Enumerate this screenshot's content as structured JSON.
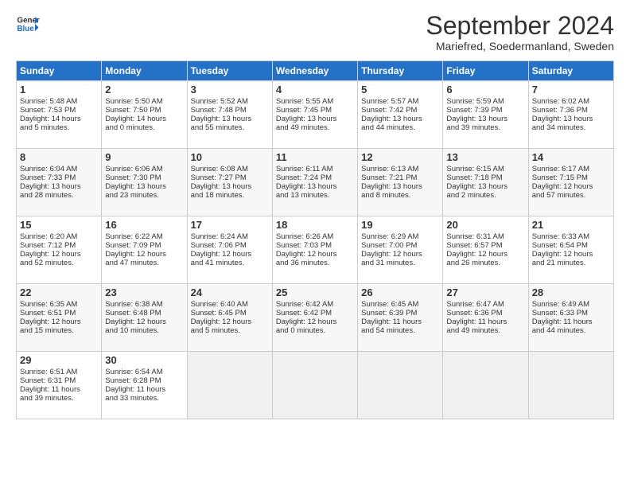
{
  "header": {
    "logo_line1": "General",
    "logo_line2": "Blue",
    "month": "September 2024",
    "location": "Mariefred, Soedermanland, Sweden"
  },
  "weekdays": [
    "Sunday",
    "Monday",
    "Tuesday",
    "Wednesday",
    "Thursday",
    "Friday",
    "Saturday"
  ],
  "weeks": [
    [
      {
        "day": "1",
        "lines": [
          "Sunrise: 5:48 AM",
          "Sunset: 7:53 PM",
          "Daylight: 14 hours",
          "and 5 minutes."
        ]
      },
      {
        "day": "2",
        "lines": [
          "Sunrise: 5:50 AM",
          "Sunset: 7:50 PM",
          "Daylight: 14 hours",
          "and 0 minutes."
        ]
      },
      {
        "day": "3",
        "lines": [
          "Sunrise: 5:52 AM",
          "Sunset: 7:48 PM",
          "Daylight: 13 hours",
          "and 55 minutes."
        ]
      },
      {
        "day": "4",
        "lines": [
          "Sunrise: 5:55 AM",
          "Sunset: 7:45 PM",
          "Daylight: 13 hours",
          "and 49 minutes."
        ]
      },
      {
        "day": "5",
        "lines": [
          "Sunrise: 5:57 AM",
          "Sunset: 7:42 PM",
          "Daylight: 13 hours",
          "and 44 minutes."
        ]
      },
      {
        "day": "6",
        "lines": [
          "Sunrise: 5:59 AM",
          "Sunset: 7:39 PM",
          "Daylight: 13 hours",
          "and 39 minutes."
        ]
      },
      {
        "day": "7",
        "lines": [
          "Sunrise: 6:02 AM",
          "Sunset: 7:36 PM",
          "Daylight: 13 hours",
          "and 34 minutes."
        ]
      }
    ],
    [
      {
        "day": "8",
        "lines": [
          "Sunrise: 6:04 AM",
          "Sunset: 7:33 PM",
          "Daylight: 13 hours",
          "and 28 minutes."
        ]
      },
      {
        "day": "9",
        "lines": [
          "Sunrise: 6:06 AM",
          "Sunset: 7:30 PM",
          "Daylight: 13 hours",
          "and 23 minutes."
        ]
      },
      {
        "day": "10",
        "lines": [
          "Sunrise: 6:08 AM",
          "Sunset: 7:27 PM",
          "Daylight: 13 hours",
          "and 18 minutes."
        ]
      },
      {
        "day": "11",
        "lines": [
          "Sunrise: 6:11 AM",
          "Sunset: 7:24 PM",
          "Daylight: 13 hours",
          "and 13 minutes."
        ]
      },
      {
        "day": "12",
        "lines": [
          "Sunrise: 6:13 AM",
          "Sunset: 7:21 PM",
          "Daylight: 13 hours",
          "and 8 minutes."
        ]
      },
      {
        "day": "13",
        "lines": [
          "Sunrise: 6:15 AM",
          "Sunset: 7:18 PM",
          "Daylight: 13 hours",
          "and 2 minutes."
        ]
      },
      {
        "day": "14",
        "lines": [
          "Sunrise: 6:17 AM",
          "Sunset: 7:15 PM",
          "Daylight: 12 hours",
          "and 57 minutes."
        ]
      }
    ],
    [
      {
        "day": "15",
        "lines": [
          "Sunrise: 6:20 AM",
          "Sunset: 7:12 PM",
          "Daylight: 12 hours",
          "and 52 minutes."
        ]
      },
      {
        "day": "16",
        "lines": [
          "Sunrise: 6:22 AM",
          "Sunset: 7:09 PM",
          "Daylight: 12 hours",
          "and 47 minutes."
        ]
      },
      {
        "day": "17",
        "lines": [
          "Sunrise: 6:24 AM",
          "Sunset: 7:06 PM",
          "Daylight: 12 hours",
          "and 41 minutes."
        ]
      },
      {
        "day": "18",
        "lines": [
          "Sunrise: 6:26 AM",
          "Sunset: 7:03 PM",
          "Daylight: 12 hours",
          "and 36 minutes."
        ]
      },
      {
        "day": "19",
        "lines": [
          "Sunrise: 6:29 AM",
          "Sunset: 7:00 PM",
          "Daylight: 12 hours",
          "and 31 minutes."
        ]
      },
      {
        "day": "20",
        "lines": [
          "Sunrise: 6:31 AM",
          "Sunset: 6:57 PM",
          "Daylight: 12 hours",
          "and 26 minutes."
        ]
      },
      {
        "day": "21",
        "lines": [
          "Sunrise: 6:33 AM",
          "Sunset: 6:54 PM",
          "Daylight: 12 hours",
          "and 21 minutes."
        ]
      }
    ],
    [
      {
        "day": "22",
        "lines": [
          "Sunrise: 6:35 AM",
          "Sunset: 6:51 PM",
          "Daylight: 12 hours",
          "and 15 minutes."
        ]
      },
      {
        "day": "23",
        "lines": [
          "Sunrise: 6:38 AM",
          "Sunset: 6:48 PM",
          "Daylight: 12 hours",
          "and 10 minutes."
        ]
      },
      {
        "day": "24",
        "lines": [
          "Sunrise: 6:40 AM",
          "Sunset: 6:45 PM",
          "Daylight: 12 hours",
          "and 5 minutes."
        ]
      },
      {
        "day": "25",
        "lines": [
          "Sunrise: 6:42 AM",
          "Sunset: 6:42 PM",
          "Daylight: 12 hours",
          "and 0 minutes."
        ]
      },
      {
        "day": "26",
        "lines": [
          "Sunrise: 6:45 AM",
          "Sunset: 6:39 PM",
          "Daylight: 11 hours",
          "and 54 minutes."
        ]
      },
      {
        "day": "27",
        "lines": [
          "Sunrise: 6:47 AM",
          "Sunset: 6:36 PM",
          "Daylight: 11 hours",
          "and 49 minutes."
        ]
      },
      {
        "day": "28",
        "lines": [
          "Sunrise: 6:49 AM",
          "Sunset: 6:33 PM",
          "Daylight: 11 hours",
          "and 44 minutes."
        ]
      }
    ],
    [
      {
        "day": "29",
        "lines": [
          "Sunrise: 6:51 AM",
          "Sunset: 6:31 PM",
          "Daylight: 11 hours",
          "and 39 minutes."
        ]
      },
      {
        "day": "30",
        "lines": [
          "Sunrise: 6:54 AM",
          "Sunset: 6:28 PM",
          "Daylight: 11 hours",
          "and 33 minutes."
        ]
      },
      null,
      null,
      null,
      null,
      null
    ]
  ]
}
